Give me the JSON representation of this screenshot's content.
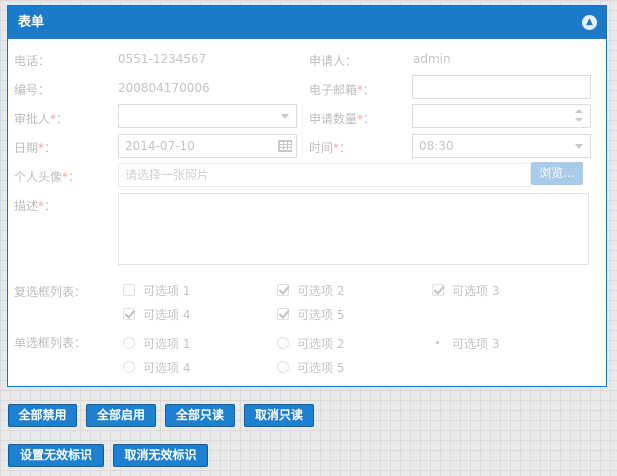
{
  "panel": {
    "title": "表单"
  },
  "form": {
    "phone": {
      "label": "电话：",
      "value": "0551-1234567"
    },
    "applicant": {
      "label": "申请人：",
      "value": "admin"
    },
    "number": {
      "label": "编号：",
      "value": "200804170006"
    },
    "email": {
      "label": "电子邮箱",
      "required": "*",
      "colon": "：",
      "value": ""
    },
    "approver": {
      "label": "审批人",
      "required": "*",
      "colon": "：",
      "value": ""
    },
    "quantity": {
      "label": "申请数量",
      "required": "*",
      "colon": "：",
      "value": ""
    },
    "date": {
      "label": "日期",
      "required": "*",
      "colon": "：",
      "value": "2014-07-10"
    },
    "time": {
      "label": "时间",
      "required": "*",
      "colon": "：",
      "value": "08:30"
    },
    "avatar": {
      "label": "个人头像",
      "required": "*",
      "colon": "：",
      "placeholder": "请选择一张照片",
      "browse_label": "浏览..."
    },
    "description": {
      "label": "描述",
      "required": "*",
      "colon": "：",
      "value": ""
    },
    "checkbox_list": {
      "label": "复选框列表：",
      "options": [
        {
          "label": "可选项 1",
          "checked": false
        },
        {
          "label": "可选项 2",
          "checked": true
        },
        {
          "label": "可选项 3",
          "checked": true
        },
        {
          "label": "可选项 4",
          "checked": true
        },
        {
          "label": "可选项 5",
          "checked": true
        }
      ]
    },
    "radio_list": {
      "label": "单选框列表：",
      "options": [
        {
          "label": "可选项 1",
          "checked": false
        },
        {
          "label": "可选项 2",
          "checked": false
        },
        {
          "label": "可选项 3",
          "checked": true
        },
        {
          "label": "可选项 4",
          "checked": false
        },
        {
          "label": "可选项 5",
          "checked": false
        }
      ]
    }
  },
  "actions": {
    "disable_all": "全部禁用",
    "enable_all": "全部启用",
    "readonly_all": "全部只读",
    "cancel_readonly": "取消只读",
    "set_invalid": "设置无效标识",
    "cancel_invalid": "取消无效标识"
  },
  "colors": {
    "header": "#1a7bcb",
    "button": "#1e80d0",
    "browse_disabled": "#a9cbea"
  },
  "icons": [
    "chevron-up-icon",
    "caret-down-icon",
    "spinner-icon",
    "calendar-icon",
    "checkmark-icon"
  ]
}
